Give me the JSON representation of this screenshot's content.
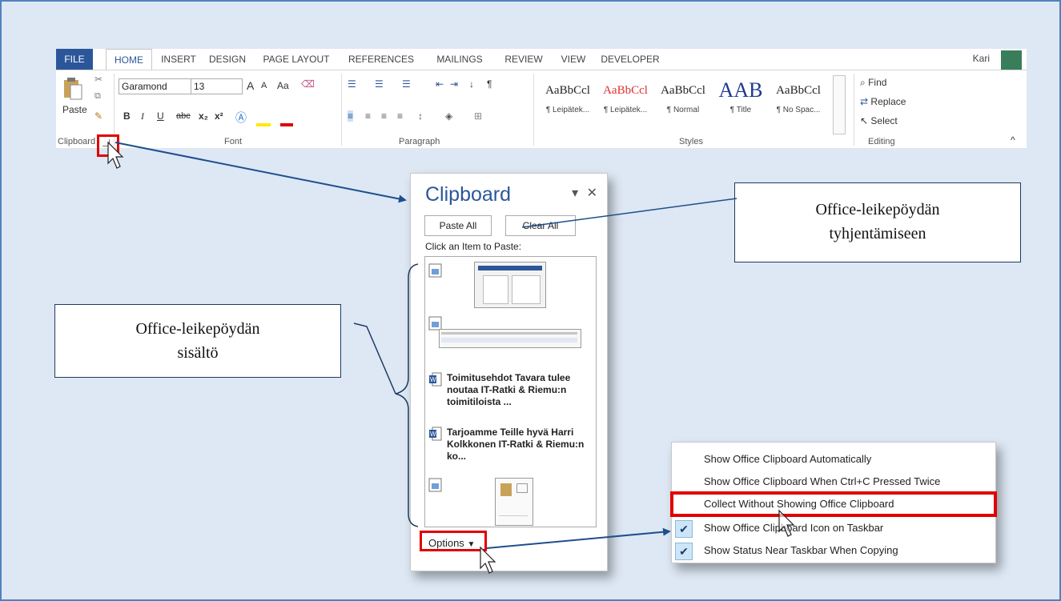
{
  "ribbon": {
    "tabs": [
      "FILE",
      "HOME",
      "INSERT",
      "DESIGN",
      "PAGE LAYOUT",
      "REFERENCES",
      "MAILINGS",
      "REVIEW",
      "VIEW",
      "DEVELOPER"
    ],
    "user": "Kari",
    "clipboard": {
      "paste_label": "Paste",
      "group": "Clipboard"
    },
    "font": {
      "name": "Garamond",
      "size": "13",
      "group": "Font",
      "case": "Aa",
      "bold": "B",
      "italic": "I",
      "underline": "U",
      "strike": "abc",
      "sub": "x₂",
      "sup": "x²",
      "grow": "A",
      "shrink": "A"
    },
    "paragraph": {
      "group": "Paragraph",
      "pilcrow": "¶"
    },
    "styles": {
      "group": "Styles",
      "items": [
        {
          "sample": "AaBbCcl",
          "name": "¶ Leipätek...",
          "color": "#222222"
        },
        {
          "sample": "AaBbCcl",
          "name": "¶ Leipätek...",
          "color": "#e03030"
        },
        {
          "sample": "AaBbCcl",
          "name": "¶ Normal",
          "color": "#222222"
        },
        {
          "sample": "AAB",
          "name": "¶ Title",
          "color": "#1f3a8f"
        },
        {
          "sample": "AaBbCcl",
          "name": "¶ No Spac...",
          "color": "#222222"
        }
      ]
    },
    "editing": {
      "group": "Editing",
      "find": "Find",
      "replace": "Replace",
      "select": "Select"
    }
  },
  "pane": {
    "title": "Clipboard",
    "paste_all": "Paste All",
    "clear_all": "Clear All",
    "hint": "Click an Item to Paste:",
    "items": [
      {
        "type": "image"
      },
      {
        "type": "image"
      },
      {
        "type": "word",
        "text": "Toimitusehdot Tavara tulee noutaa IT-Ratki & Riemu:n toimitiloista ..."
      },
      {
        "type": "word",
        "text": "Tarjoamme Teille hyvä Harri Kolkkonen IT-Ratki & Riemu:n ko..."
      },
      {
        "type": "image"
      }
    ],
    "options": "Options"
  },
  "menu": {
    "items": [
      {
        "text": "Show Office Clipboard Automatically",
        "checked": false
      },
      {
        "text": "Show Office Clipboard When Ctrl+C Pressed Twice",
        "checked": false
      },
      {
        "text": "Collect Without Showing Office Clipboard",
        "checked": false
      },
      {
        "text": "Show Office Clipboard Icon on Taskbar",
        "checked": true
      },
      {
        "text": "Show Status Near Taskbar When Copying",
        "checked": true
      }
    ]
  },
  "callouts": {
    "clear": "Office-leikepöydän tyhjentämiseen",
    "content": "Office-leikepöydän sisältö"
  },
  "colors": {
    "accent": "#2b579a",
    "highlight": "#e00000",
    "arrow": "#1f4e8c",
    "background": "#dde8f4"
  }
}
